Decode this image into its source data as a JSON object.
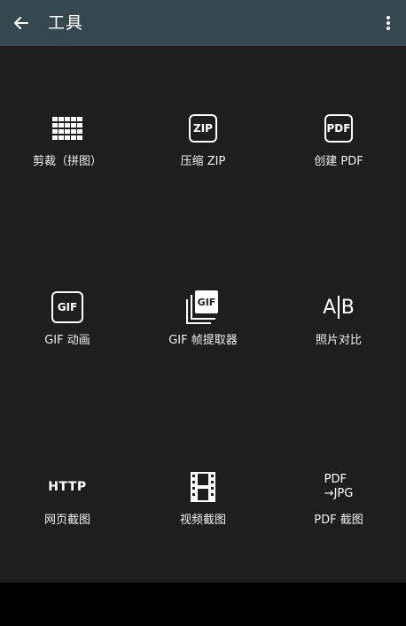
{
  "appbar": {
    "title": "工具"
  },
  "tools": [
    {
      "label": "剪裁（拼图）"
    },
    {
      "label": "压缩 ZIP",
      "icon_text": "ZIP"
    },
    {
      "label": "创建 PDF",
      "icon_text": "PDF"
    },
    {
      "label": "GIF 动画",
      "icon_text": "GIF"
    },
    {
      "label": "GIF 帧提取器",
      "icon_text": "GIF"
    },
    {
      "label": "照片对比",
      "icon_a": "A",
      "icon_b": "B"
    },
    {
      "label": "网页截图",
      "icon_text": "HTTP"
    },
    {
      "label": "视频截图"
    },
    {
      "label": "PDF 截图",
      "icon_line1": "PDF",
      "icon_line2": "→JPG"
    }
  ],
  "colors": {
    "appbar": "#37474f",
    "content": "#1e1e1e",
    "text": "#ffffff"
  }
}
